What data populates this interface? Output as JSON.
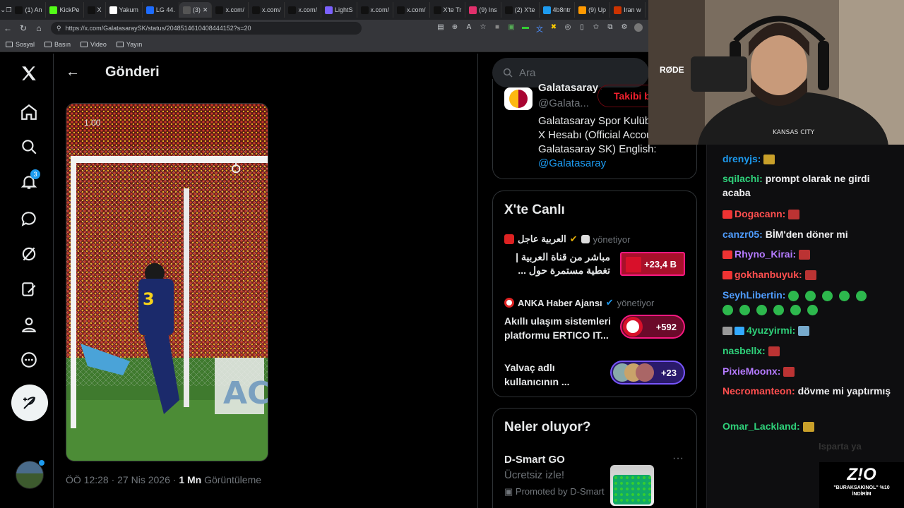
{
  "browser": {
    "tabs": [
      {
        "label": "(1) An",
        "color": "#111"
      },
      {
        "label": "KickPe",
        "color": "#53fc18"
      },
      {
        "label": "X",
        "color": "#111"
      },
      {
        "label": "Yakum",
        "color": "#fff"
      },
      {
        "label": "LG 44.",
        "color": "#1e6cff"
      },
      {
        "label": "(3)",
        "color": "#555"
      },
      {
        "label": "x.com/",
        "color": "#111"
      },
      {
        "label": "x.com/",
        "color": "#111"
      },
      {
        "label": "x.com/",
        "color": "#111"
      },
      {
        "label": "LightS",
        "color": "#7b61ff"
      },
      {
        "label": "x.com/",
        "color": "#111"
      },
      {
        "label": "x.com/",
        "color": "#111"
      },
      {
        "label": "X'te Tr",
        "color": "#111"
      },
      {
        "label": "(9) Ins",
        "color": "#e1306c"
      },
      {
        "label": "(2) X'te",
        "color": "#111"
      },
      {
        "label": "4b8ntr",
        "color": "#1d9bf0"
      },
      {
        "label": "(9) Up",
        "color": "#f90"
      },
      {
        "label": "Iran w",
        "color": "#c30"
      }
    ],
    "url": "https://x.com/GalatasaraySK/status/2048514610408444152?s=20",
    "bookmarks": [
      "Sosyal",
      "Basın",
      "Video",
      "Yayın"
    ]
  },
  "nav": {
    "notification_count": "3"
  },
  "post": {
    "header_title": "Gönderi",
    "overlay_text": "1.00",
    "time": "ÖÖ 12:28 · 27 Nis 2026 · ",
    "views": "1 Mn",
    "views_label": " Görüntüleme"
  },
  "search": {
    "placeholder": "Ara"
  },
  "profile_card": {
    "name": "Galatasaray Spor Kulübü",
    "handle": "@Galata...",
    "follow": "Takibi bırak",
    "bio": "Galatasaray Spor Kulübü Resmi X Hesabı (Official Account of Galatasaray SK) English: ",
    "bio_link": "@Galatasaray"
  },
  "live": {
    "title": "X'te Canlı",
    "items": [
      {
        "host": "العربية عاجل",
        "role": "yönetiyor",
        "text": "مباشر من قناة العربية | تغطية مستمرة حول ...",
        "count": "+23,4 B"
      },
      {
        "host": "ANKA Haber Ajansı",
        "role": "yönetiyor",
        "text": "Akıllı ulaşım sistemleri platformu ERTICO IT...",
        "count": "+592"
      },
      {
        "host": "",
        "role": "",
        "text": "Yalvaç adlı kullanıcının ...",
        "count": "+23"
      }
    ]
  },
  "trends": {
    "title": "Neler oluyor?",
    "ad_name": "D-Smart GO",
    "ad_sub": "Ücretsiz izle!",
    "ad_promo": "Promoted by D-Smart"
  },
  "chat": [
    {
      "user": "drenyjs:",
      "user_color": "#1d9bf0",
      "msg": ""
    },
    {
      "user": "sqilachi:",
      "user_color": "#2fd27b",
      "msg": "prompt olarak ne girdi acaba"
    },
    {
      "user": "Dogacann:",
      "user_color": "#ff4f4f",
      "msg": ""
    },
    {
      "user": "canzr05:",
      "user_color": "#4f9dff",
      "msg": "BİM'den döner mi"
    },
    {
      "user": "Rhyno_Kirai:",
      "user_color": "#b57bff",
      "msg": ""
    },
    {
      "user": "gokhanbuyuk:",
      "user_color": "#ff4f4f",
      "msg": ""
    },
    {
      "user": "SeyhLibertin:",
      "user_color": "#4f9dff",
      "msg": ""
    },
    {
      "user": "4yuzyirmi:",
      "user_color": "#2fd27b",
      "msg": ""
    },
    {
      "user": "nasbellx:",
      "user_color": "#2fd27b",
      "msg": ""
    },
    {
      "user": "PixieMoonx:",
      "user_color": "#b57bff",
      "msg": ""
    },
    {
      "user": "Necromanteon:",
      "user_color": "#ff4f4f",
      "msg": "dövme mi yaptırmış"
    },
    {
      "user": "Omar_Lackland:",
      "user_color": "#2fd27b",
      "msg": ""
    }
  ],
  "stream": {
    "brand_mark": "RØDE",
    "logo_text": "Z!O",
    "promo": "\"BURAKSAKINOL\" %10 İNDİRİM",
    "faded": "Isparta ya"
  }
}
